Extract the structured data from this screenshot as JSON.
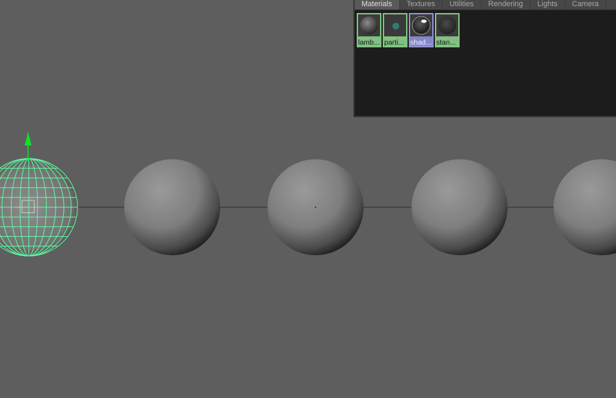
{
  "hypershade": {
    "tabs": [
      {
        "label": "Materials",
        "active": true
      },
      {
        "label": "Textures",
        "active": false
      },
      {
        "label": "Utilities",
        "active": false
      },
      {
        "label": "Rendering",
        "active": false
      },
      {
        "label": "Lights",
        "active": false
      },
      {
        "label": "Camera",
        "active": false
      }
    ],
    "swatches": [
      {
        "label": "lamb...",
        "icon": "lambert-sphere",
        "selected": false
      },
      {
        "label": "parti...",
        "icon": "particle-checker",
        "selected": false
      },
      {
        "label": "shad...",
        "icon": "shader-glossy-sphere",
        "selected": true
      },
      {
        "label": "stan...",
        "icon": "standard-dark-sphere",
        "selected": false
      }
    ]
  },
  "viewport": {
    "background_color": "#5e5e5e",
    "wireframe_color": "#5dffa0",
    "manipulator_color": "#10e02a",
    "sphere_count": 5,
    "selected_sphere": 1
  }
}
